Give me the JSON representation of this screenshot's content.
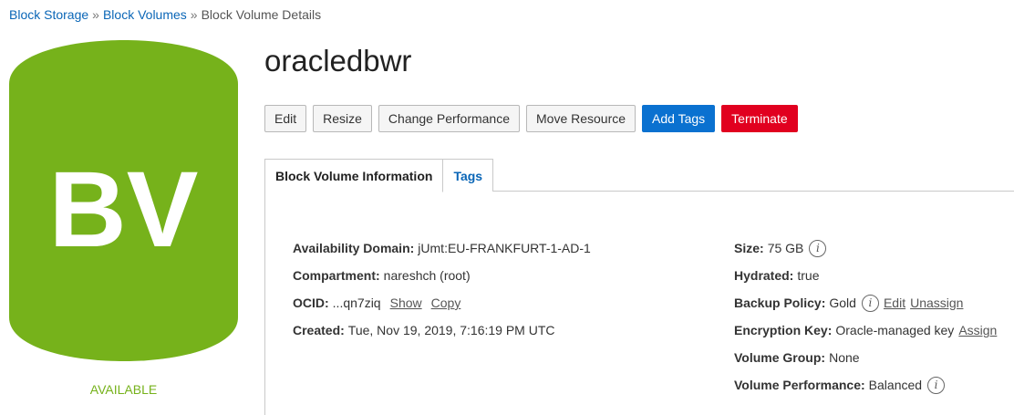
{
  "breadcrumb": {
    "items": [
      {
        "label": "Block Storage"
      },
      {
        "label": "Block Volumes"
      },
      {
        "label": "Block Volume Details"
      }
    ],
    "separator": "»"
  },
  "resource": {
    "icon_text": "BV",
    "icon_color": "#76b21b",
    "status": "AVAILABLE",
    "status_color": "#76b21b"
  },
  "page_title": "oracledbwr",
  "toolbar": {
    "edit": "Edit",
    "resize": "Resize",
    "change_performance": "Change Performance",
    "move_resource": "Move Resource",
    "add_tags": "Add Tags",
    "terminate": "Terminate"
  },
  "tabs": {
    "info": "Block Volume Information",
    "tags": "Tags"
  },
  "details_left": {
    "availability_domain": {
      "label": "Availability Domain:",
      "value": "jUmt:EU-FRANKFURT-1-AD-1"
    },
    "compartment": {
      "label": "Compartment:",
      "value": "nareshch (root)"
    },
    "ocid": {
      "label": "OCID:",
      "value": "...qn7ziq",
      "show": "Show",
      "copy": "Copy"
    },
    "created": {
      "label": "Created:",
      "value": "Tue, Nov 19, 2019, 7:16:19 PM UTC"
    }
  },
  "details_right": {
    "size": {
      "label": "Size:",
      "value": "75 GB"
    },
    "hydrated": {
      "label": "Hydrated:",
      "value": "true"
    },
    "backup_policy": {
      "label": "Backup Policy:",
      "value": "Gold",
      "edit": "Edit",
      "unassign": "Unassign"
    },
    "encryption_key": {
      "label": "Encryption Key:",
      "value": "Oracle-managed key",
      "assign": "Assign"
    },
    "volume_group": {
      "label": "Volume Group:",
      "value": "None"
    },
    "volume_performance": {
      "label": "Volume Performance:",
      "value": "Balanced"
    }
  },
  "info_icon_glyph": "i"
}
